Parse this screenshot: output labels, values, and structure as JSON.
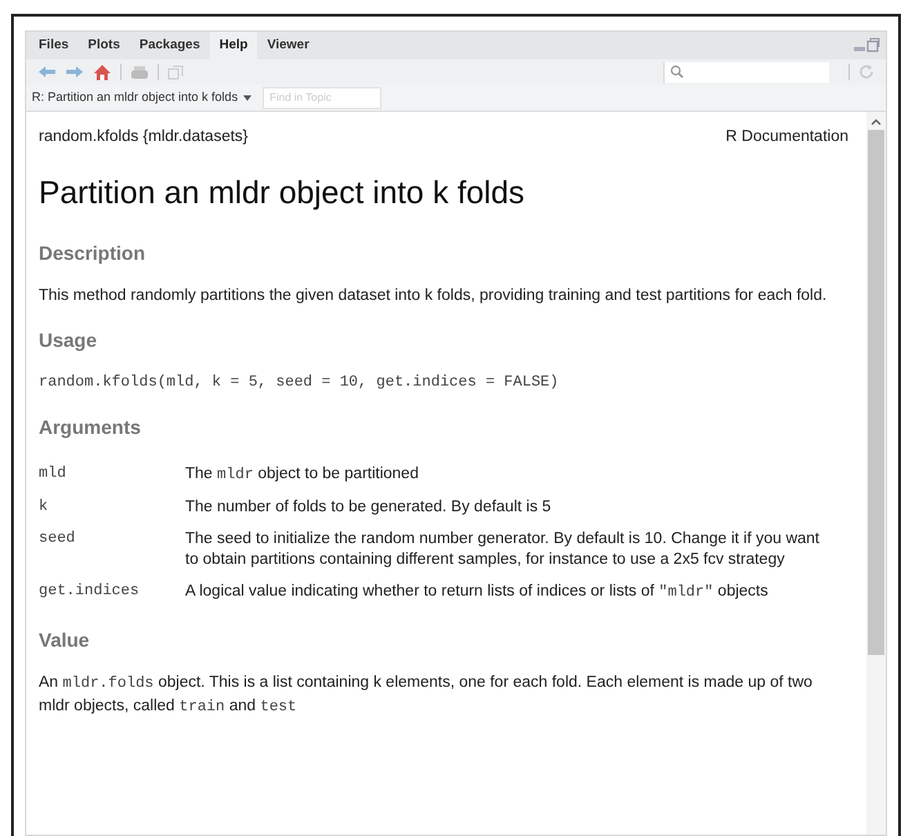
{
  "tabs": [
    {
      "label": "Files",
      "selected": false
    },
    {
      "label": "Plots",
      "selected": false
    },
    {
      "label": "Packages",
      "selected": false
    },
    {
      "label": "Help",
      "selected": true
    },
    {
      "label": "Viewer",
      "selected": false
    }
  ],
  "topic": {
    "label": "R: Partition an mldr object into k folds",
    "find_placeholder": "Find in Topic"
  },
  "doc": {
    "header_left": "random.kfolds {mldr.datasets}",
    "header_right": "R Documentation",
    "title": "Partition an mldr object into k folds",
    "sections": [
      {
        "heading": "Description",
        "kind": "text",
        "body": [
          [
            {
              "kind": "text",
              "text": "This method randomly partitions the given dataset into k folds, providing training and test partitions for each fold."
            }
          ]
        ]
      },
      {
        "heading": "Usage",
        "kind": "code",
        "code": "random.kfolds(mld, k = 5, seed = 10, get.indices = FALSE)"
      },
      {
        "heading": "Arguments",
        "kind": "args",
        "args": [
          {
            "name": "mld",
            "desc": [
              {
                "kind": "text",
                "text": "The "
              },
              {
                "kind": "code",
                "text": "mldr"
              },
              {
                "kind": "text",
                "text": " object to be partitioned"
              }
            ]
          },
          {
            "name": "k",
            "desc": [
              {
                "kind": "text",
                "text": "The number of folds to be generated. By default is 5"
              }
            ]
          },
          {
            "name": "seed",
            "desc": [
              {
                "kind": "text",
                "text": "The seed to initialize the random number generator. By default is 10. Change it if you want to obtain partitions containing different samples, for instance to use a 2x5 fcv strategy"
              }
            ]
          },
          {
            "name": "get.indices",
            "desc": [
              {
                "kind": "text",
                "text": "A logical value indicating whether to return lists of indices or lists of "
              },
              {
                "kind": "code",
                "text": "\"mldr\""
              },
              {
                "kind": "text",
                "text": " objects"
              }
            ]
          }
        ]
      },
      {
        "heading": "Value",
        "kind": "text",
        "body": [
          [
            {
              "kind": "text",
              "text": "An "
            },
            {
              "kind": "code",
              "text": "mldr.folds"
            },
            {
              "kind": "text",
              "text": " object. This is a list containing k elements, one for each fold. Each element is made up of two mldr objects, called "
            },
            {
              "kind": "code",
              "text": "train"
            },
            {
              "kind": "text",
              "text": " and "
            },
            {
              "kind": "code",
              "text": "test"
            }
          ]
        ]
      }
    ]
  }
}
